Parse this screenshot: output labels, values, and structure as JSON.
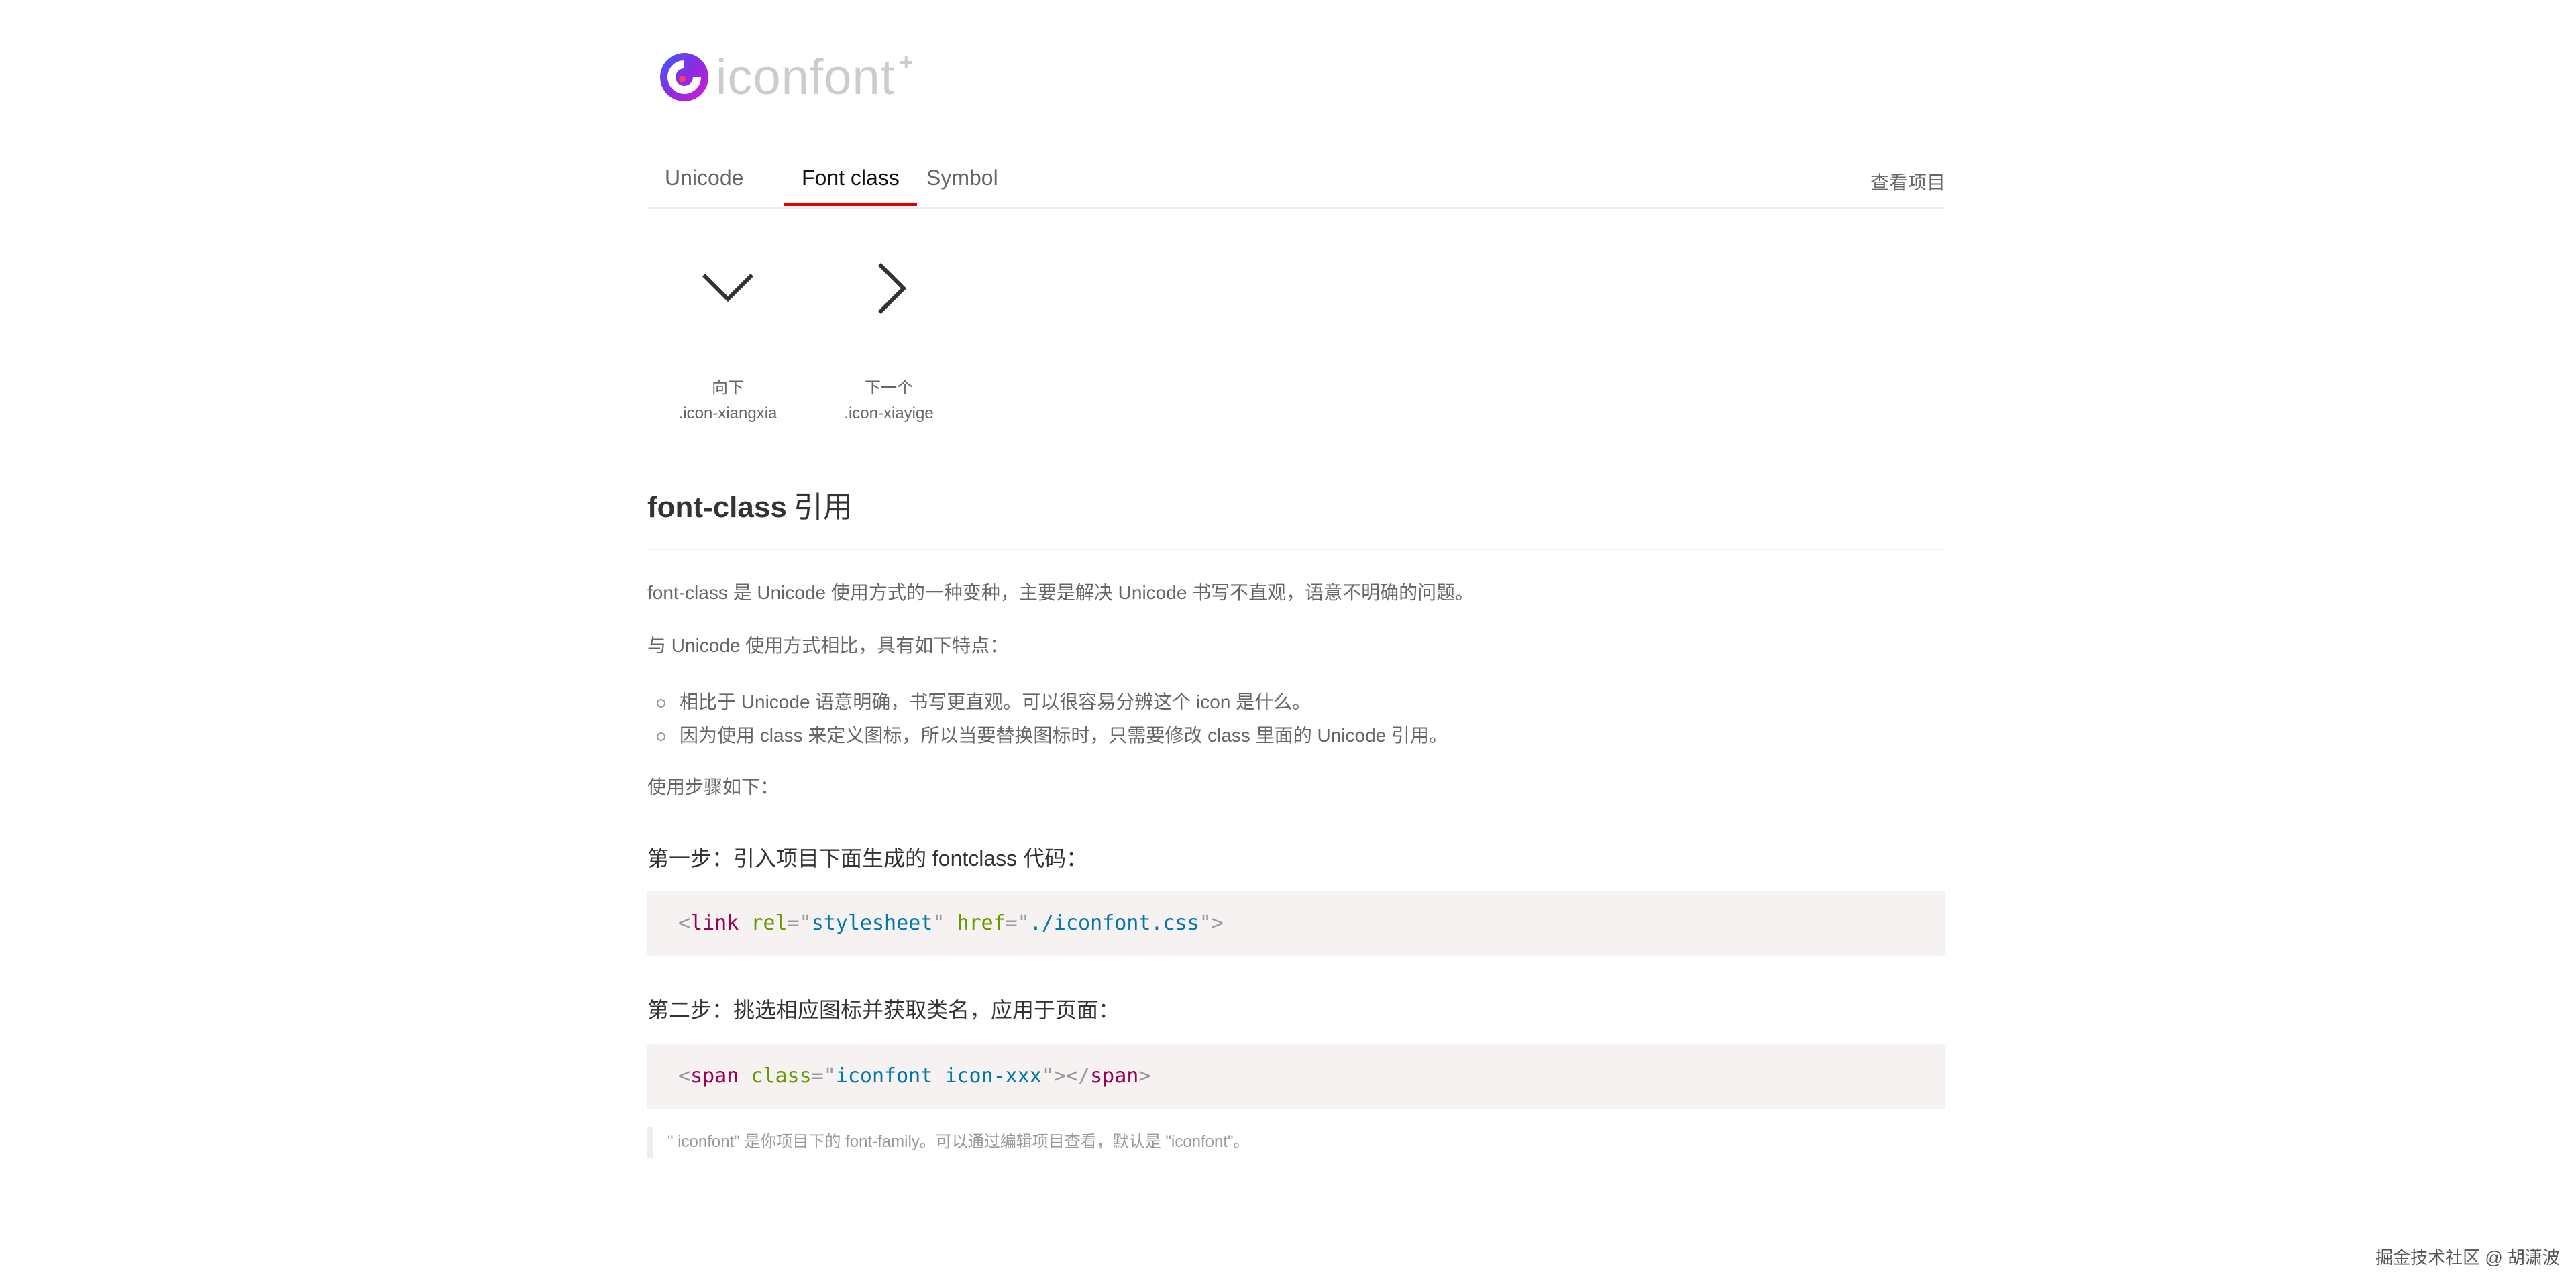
{
  "logo": {
    "text": "iconfont",
    "plus": "+"
  },
  "tabs": [
    {
      "label": "Unicode",
      "active": false
    },
    {
      "label": "Font class",
      "active": true
    },
    {
      "label": "Symbol",
      "active": false
    }
  ],
  "header": {
    "view_project_label": "查看项目"
  },
  "icons": [
    {
      "name": "向下",
      "code": ".icon-xiangxia",
      "glyph": "chevron-down-icon"
    },
    {
      "name": "下一个",
      "code": ".icon-xiayige",
      "glyph": "chevron-right-icon"
    }
  ],
  "section": {
    "title_en": "font-class",
    "title_zh": "引用"
  },
  "paragraphs": {
    "intro": "font-class 是 Unicode 使用方式的一种变种，主要是解决 Unicode 书写不直观，语意不明确的问题。",
    "compare": "与 Unicode 使用方式相比，具有如下特点：",
    "steps_intro": "使用步骤如下："
  },
  "bullets": [
    "相比于 Unicode 语意明确，书写更直观。可以很容易分辨这个 icon 是什么。",
    "因为使用 class 来定义图标，所以当要替换图标时，只需要修改 class 里面的 Unicode 引用。"
  ],
  "steps": {
    "step1": "第一步：引入项目下面生成的 fontclass 代码：",
    "step2": "第二步：挑选相应图标并获取类名，应用于页面："
  },
  "code": {
    "line1": {
      "open": "<",
      "tag": "link",
      "attr1": "rel",
      "eq1": "=\"",
      "val1": "stylesheet",
      "close1": "\"",
      "attr2": "href",
      "eq2": "=\"",
      "val2": "./iconfont.css",
      "close2": "\">"
    },
    "line2": {
      "open": "<",
      "tag": "span",
      "attr1": "class",
      "eq1": "=\"",
      "val1": "iconfont icon-xxx",
      "close1": "\"></",
      "tag2": "span",
      "close2": ">"
    }
  },
  "note": "\" iconfont\" 是你项目下的 font-family。可以通过编辑项目查看，默认是 \"iconfont\"。",
  "watermark": "掘金技术社区 @ 胡潇波",
  "colors": {
    "accent": "#e50000",
    "code_bg": "#f6f2f2",
    "tag": "#990055",
    "attr": "#669900",
    "value": "#0077aa"
  }
}
